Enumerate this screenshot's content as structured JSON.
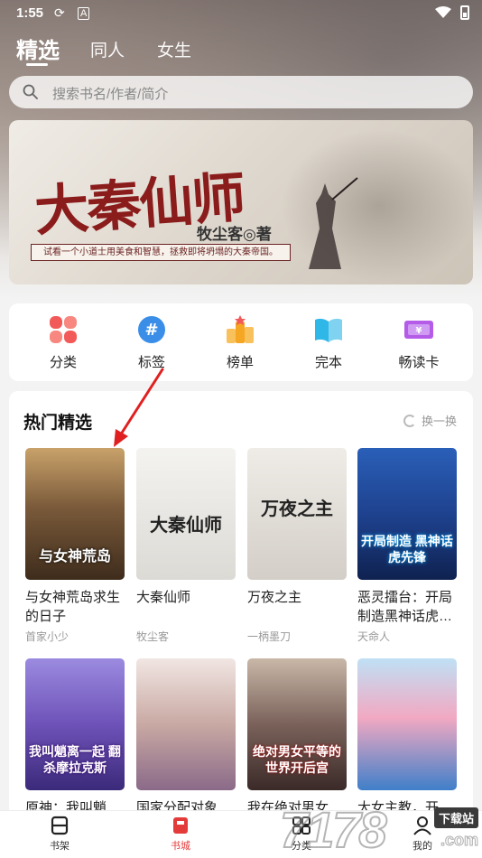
{
  "status_bar": {
    "time": "1:55",
    "icons": [
      "sync-icon",
      "a-badge-icon",
      "wifi-icon",
      "battery-icon"
    ]
  },
  "tabs": [
    {
      "label": "精选",
      "active": true
    },
    {
      "label": "同人",
      "active": false
    },
    {
      "label": "女生",
      "active": false
    }
  ],
  "search": {
    "placeholder": "搜索书名/作者/简介"
  },
  "banner": {
    "title": "大秦仙师",
    "author": "牧尘客◎著",
    "tagline": "试看一个小道士用美食和智慧，拯救即将坍塌的大秦帝国。"
  },
  "quick_nav": [
    {
      "label": "分类",
      "icon": "category-icon",
      "color": "#f25a5a"
    },
    {
      "label": "标签",
      "icon": "tag-hash-icon",
      "color": "#3a8ee8"
    },
    {
      "label": "榜单",
      "icon": "ranking-icon",
      "color": "#f5a623"
    },
    {
      "label": "完本",
      "icon": "book-open-icon",
      "color": "#2fb7e8"
    },
    {
      "label": "畅读卡",
      "icon": "ticket-icon",
      "color": "#b45ce8"
    }
  ],
  "hot": {
    "title": "热门精选",
    "refresh_label": "换一换",
    "books": [
      {
        "title": "与女神荒岛求生的日子",
        "author": "首家小少",
        "cover_text": "与女神荒岛",
        "cover_bg": "#6b4a2e",
        "cover_fg": "#ffffff"
      },
      {
        "title": "大秦仙师",
        "author": "牧尘客",
        "cover_text": "大秦仙师",
        "cover_bg": "#ecebe8",
        "cover_fg": "#222222"
      },
      {
        "title": "万夜之主",
        "author": "一柄墨刀",
        "cover_text": "万夜之主",
        "cover_bg": "#e9e6e1",
        "cover_fg": "#222222"
      },
      {
        "title": "恶灵擂台：开局制造黑神话虎…",
        "author": "天命人",
        "cover_text": "开局制造 黑神话虎先锋",
        "cover_bg": "#1d3f8a",
        "cover_fg": "#ffffff"
      },
      {
        "title": "原神：我叫魈离…",
        "author": "",
        "cover_text": "我叫魈离一起 翻杀摩拉克斯",
        "cover_bg": "#6e52b8",
        "cover_fg": "#ffffff"
      },
      {
        "title": "国家分配对象的…",
        "author": "",
        "cover_text": "",
        "cover_bg": "#d8c7c4",
        "cover_fg": "#ffffff"
      },
      {
        "title": "我在绝对男女平…",
        "author": "",
        "cover_text": "绝对男女平等的 世界开后宫",
        "cover_bg": "#5e4a44",
        "cover_fg": "#ffffff"
      },
      {
        "title": "大女主教，开局…",
        "author": "",
        "cover_text": "",
        "cover_bg": "#5da0d8",
        "cover_fg": "#ffffff"
      }
    ]
  },
  "bottom_nav": [
    {
      "label": "书架",
      "icon": "bookshelf-icon",
      "active": false
    },
    {
      "label": "书城",
      "icon": "bookstore-icon",
      "active": true
    },
    {
      "label": "分类",
      "icon": "grid-icon",
      "active": false
    },
    {
      "label": "我的",
      "icon": "profile-icon",
      "active": false
    }
  ],
  "watermark": {
    "number": "7178",
    "badge": "下载站",
    "domain": ".com"
  }
}
